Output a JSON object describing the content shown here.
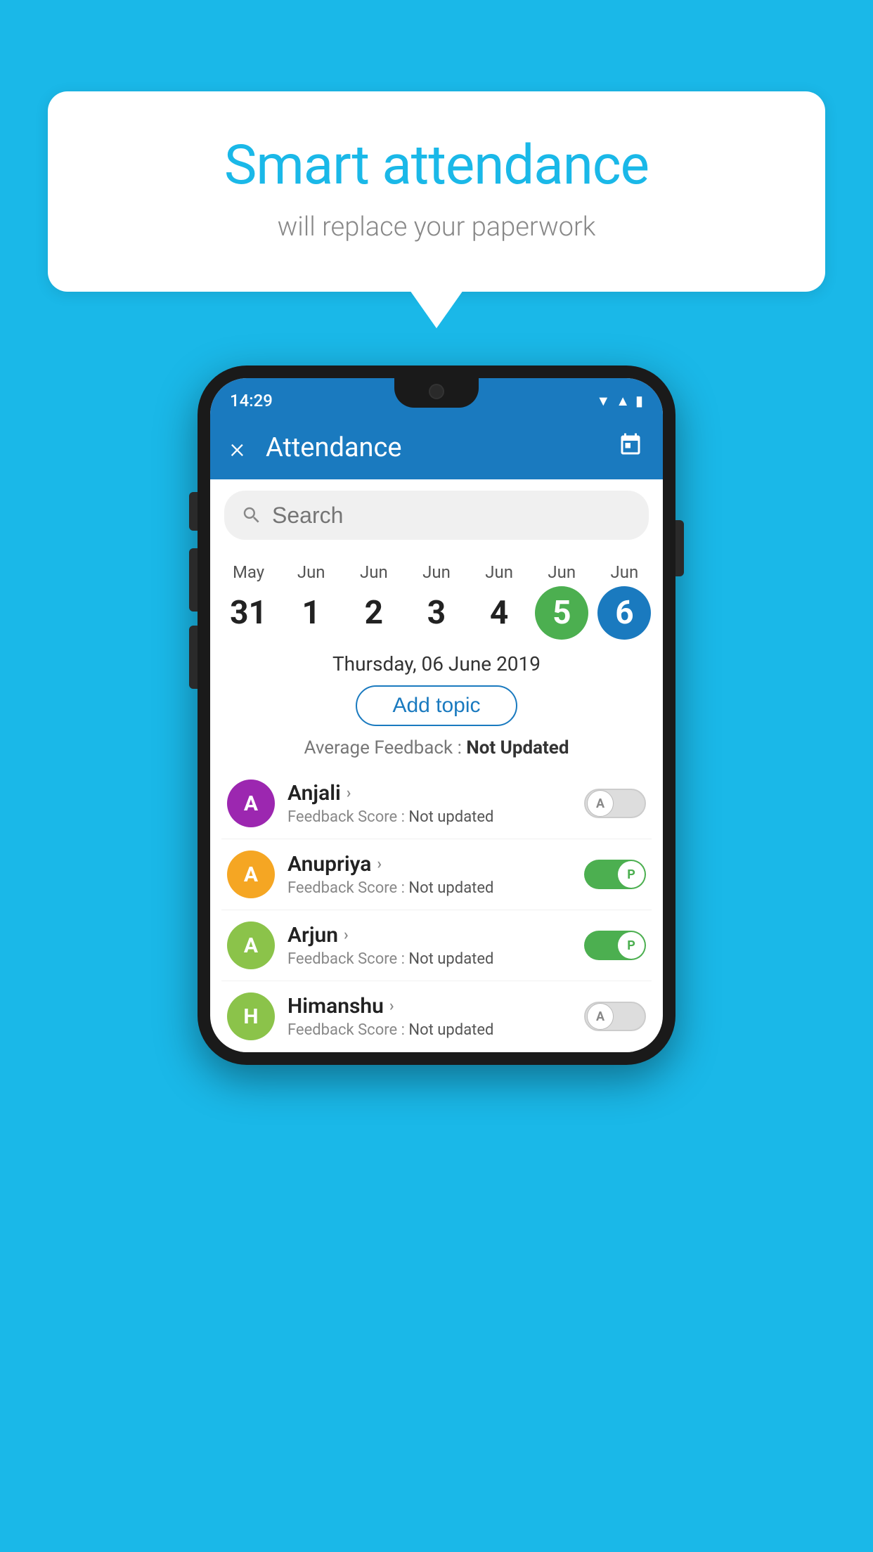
{
  "background_color": "#1ab8e8",
  "speech_bubble": {
    "title": "Smart attendance",
    "subtitle": "will replace your paperwork"
  },
  "phone": {
    "status_bar": {
      "time": "14:29",
      "icons": [
        "wifi",
        "signal",
        "battery"
      ]
    },
    "app_bar": {
      "close_label": "×",
      "title": "Attendance",
      "calendar_icon": "📅"
    },
    "search": {
      "placeholder": "Search"
    },
    "calendar": {
      "columns": [
        {
          "month": "May",
          "day": "31",
          "style": "normal"
        },
        {
          "month": "Jun",
          "day": "1",
          "style": "normal"
        },
        {
          "month": "Jun",
          "day": "2",
          "style": "normal"
        },
        {
          "month": "Jun",
          "day": "3",
          "style": "normal"
        },
        {
          "month": "Jun",
          "day": "4",
          "style": "normal"
        },
        {
          "month": "Jun",
          "day": "5",
          "style": "today"
        },
        {
          "month": "Jun",
          "day": "6",
          "style": "selected"
        }
      ]
    },
    "selected_date": "Thursday, 06 June 2019",
    "add_topic_label": "Add topic",
    "avg_feedback_label": "Average Feedback : ",
    "avg_feedback_value": "Not Updated",
    "students": [
      {
        "name": "Anjali",
        "initial": "A",
        "avatar_color": "#9c27b0",
        "feedback_label": "Feedback Score : ",
        "feedback_value": "Not updated",
        "toggle": "off",
        "toggle_letter": "A"
      },
      {
        "name": "Anupriya",
        "initial": "A",
        "avatar_color": "#f5a623",
        "feedback_label": "Feedback Score : ",
        "feedback_value": "Not updated",
        "toggle": "on",
        "toggle_letter": "P"
      },
      {
        "name": "Arjun",
        "initial": "A",
        "avatar_color": "#8bc34a",
        "feedback_label": "Feedback Score : ",
        "feedback_value": "Not updated",
        "toggle": "on",
        "toggle_letter": "P"
      },
      {
        "name": "Himanshu",
        "initial": "H",
        "avatar_color": "#8bc34a",
        "feedback_label": "Feedback Score : ",
        "feedback_value": "Not updated",
        "toggle": "off",
        "toggle_letter": "A"
      }
    ]
  }
}
